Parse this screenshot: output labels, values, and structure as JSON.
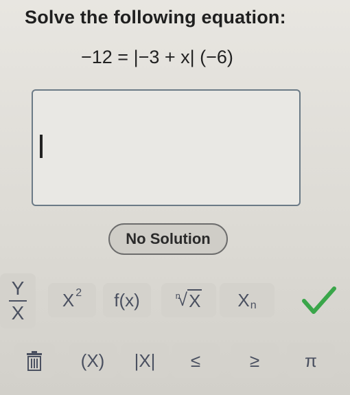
{
  "question": {
    "prompt": "Solve the following equation:",
    "equation": "−12 = |−3 + x| (−6)"
  },
  "answer": {
    "value": ""
  },
  "buttons": {
    "no_solution": "No Solution"
  },
  "keypad": {
    "row1": {
      "frac_num": "Y",
      "frac_den": "X",
      "pow_base": "X",
      "pow_exp": "2",
      "func": "f(x)",
      "root_index": "n",
      "root_radicand": "X",
      "sub_base": "X",
      "sub_index": "n"
    },
    "row2": {
      "paren": "(X)",
      "abs": "|X|",
      "le": "≤",
      "ge": "≥",
      "pi": "π"
    }
  },
  "colors": {
    "check": "#3aa64a",
    "key_text": "#4a5060"
  },
  "icons": {
    "check": "check-icon",
    "trash": "trash-icon"
  }
}
